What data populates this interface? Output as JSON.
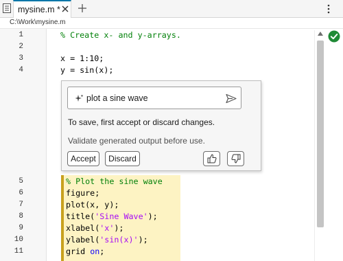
{
  "tab": {
    "label": "mysine.m *",
    "close_icon": "close-icon"
  },
  "add_tab_icon": "plus-icon",
  "menu_icon": "vertical-ellipsis-icon",
  "path": "C:\\Work\\mysine.m",
  "line_numbers": [
    "1",
    "2",
    "3",
    "4",
    "5",
    "6",
    "7",
    "8",
    "9",
    "10",
    "11"
  ],
  "code": {
    "l1": "% Create x- and y-arrays.",
    "l3": "x = 1:10;",
    "l4": "y = sin(x);",
    "l5": "% Plot the sine wave",
    "l6": "figure;",
    "l7": "plot(x, y);",
    "l8_a": "title(",
    "l8_s": "'Sine Wave'",
    "l8_b": ");",
    "l9_a": "xlabel(",
    "l9_s": "'x'",
    "l9_b": ");",
    "l10_a": "ylabel(",
    "l10_s": "'sin(x)'",
    "l10_b": ");",
    "l11_a": "grid ",
    "l11_k": "on",
    "l11_b": ";"
  },
  "copilot": {
    "prompt": "plot a sine wave",
    "message": "To save, first accept or discard changes.",
    "note": "Validate generated output before use.",
    "accept_label": "Accept",
    "discard_label": "Discard",
    "thumbs_up_icon": "thumbs-up-icon",
    "thumbs_down_icon": "thumbs-down-icon",
    "send_icon": "send-icon",
    "sparkle_icon": "sparkle-icon"
  },
  "colors": {
    "comment": "#028009",
    "string": "#a709f5",
    "keyword": "#0e00ff",
    "highlight": "#fdf3c3",
    "status_ok": "#1f8a36",
    "tab_accent": "#0076a8"
  },
  "status": {
    "icon": "check-circle-icon"
  }
}
